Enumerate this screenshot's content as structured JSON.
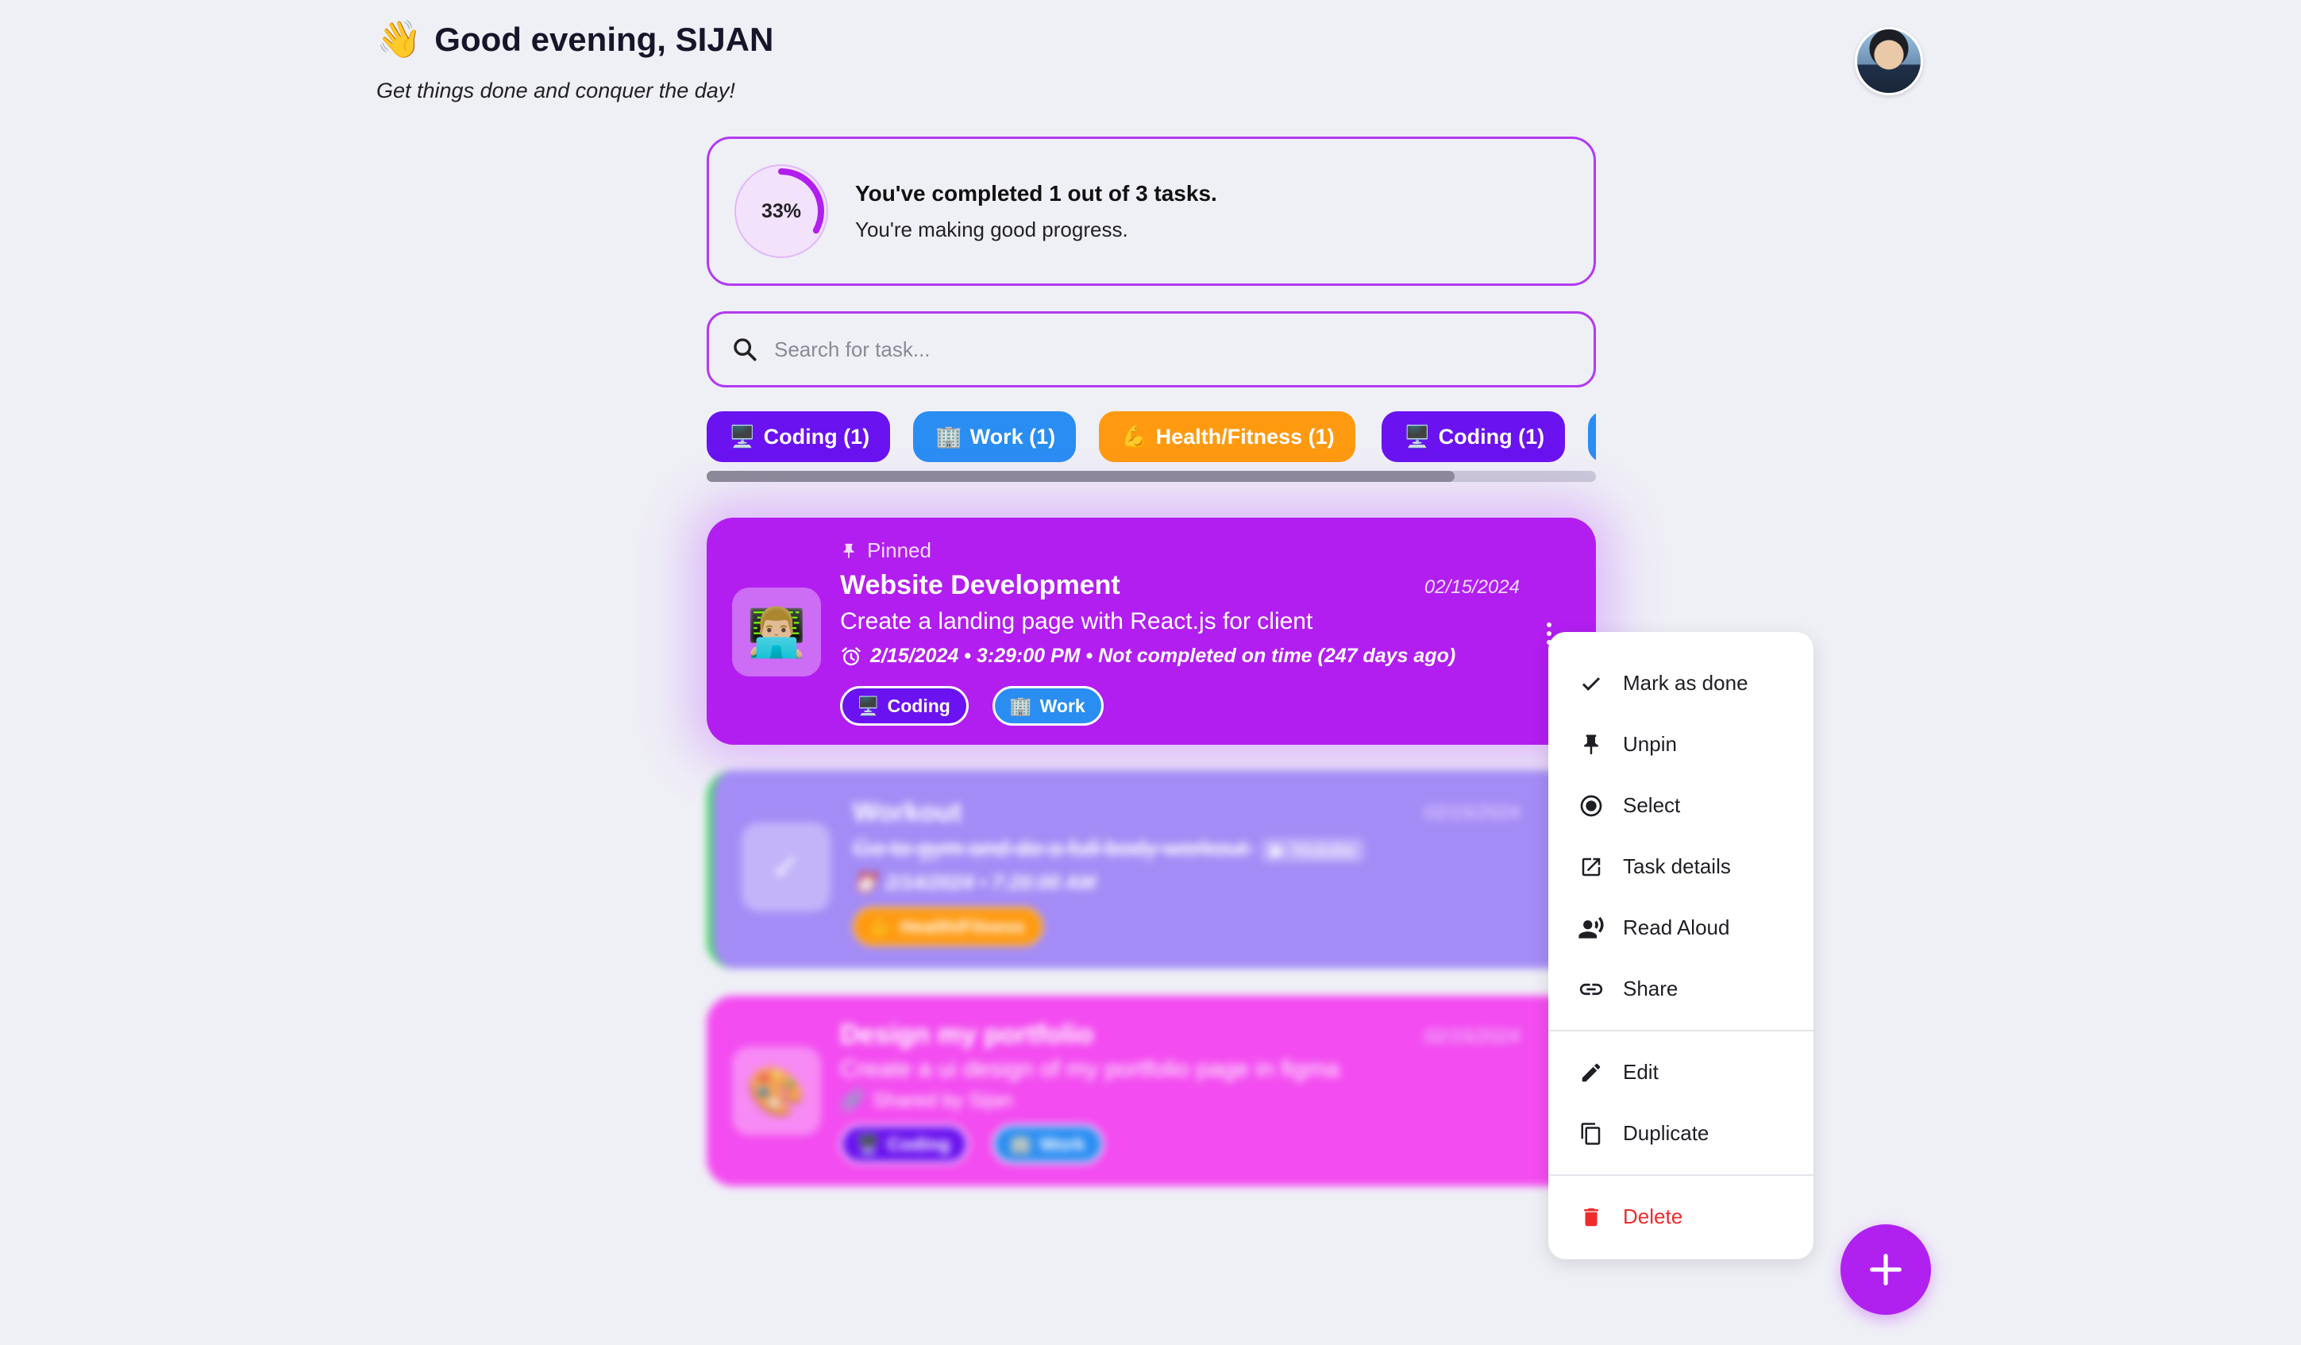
{
  "header": {
    "greeting_emoji": "👋",
    "greeting": "Good evening, SIJAN",
    "subtitle": "Get things done and conquer the day!"
  },
  "progress": {
    "percent_label": "33%",
    "percent": 33,
    "title": "You've completed 1 out of 3 tasks.",
    "subtitle": "You're making good progress.",
    "accent": "#b21ef0"
  },
  "search": {
    "placeholder": "Search for task..."
  },
  "category_chips": [
    {
      "emoji": "🖥️",
      "label": "Coding (1)",
      "color": "#6a12f0"
    },
    {
      "emoji": "🏢",
      "label": "Work (1)",
      "color": "#2a8df2"
    },
    {
      "emoji": "💪",
      "label": "Health/Fitness (1)",
      "color": "#ff9a10"
    },
    {
      "emoji": "🖥️",
      "label": "Coding (1)",
      "color": "#6a12f0"
    }
  ],
  "tasks": [
    {
      "pinned_label": "Pinned",
      "emoji": "👨🏼‍💻",
      "title": "Website Development",
      "date": "02/15/2024",
      "description": "Create a landing page with React.js for client",
      "deadline": "2/15/2024 • 3:29:00 PM • Not completed on time (247 days ago)",
      "tags": [
        {
          "emoji": "🖥️",
          "label": "Coding",
          "color": "#6a12f0"
        },
        {
          "emoji": "🏢",
          "label": "Work",
          "color": "#2a8df2"
        }
      ],
      "color": "#b21ef0"
    },
    {
      "emoji": "✓",
      "title": "Workout",
      "date": "02/15/2024",
      "description": "Go to gym and do a full body workout",
      "link_label": "Youtube",
      "deadline": "2/14/2024 • 7:20:00 AM",
      "tags": [
        {
          "emoji": "💪",
          "label": "Health/Fitness",
          "color": "#ff9a10"
        }
      ],
      "color": "#a48cf6"
    },
    {
      "emoji": "🎨",
      "title": "Design my portfolio",
      "date": "02/15/2024",
      "description": "Create a ui design of my portfolio page in figma",
      "shared": "Shared by Sijan",
      "tags": [
        {
          "emoji": "🖥️",
          "label": "Coding",
          "color": "#6a12f0"
        },
        {
          "emoji": "🏢",
          "label": "Work",
          "color": "#2a8df2"
        }
      ],
      "color": "#f34cf0"
    }
  ],
  "context_menu": {
    "items": [
      {
        "label": "Mark as done",
        "icon": "check-icon"
      },
      {
        "label": "Unpin",
        "icon": "pin-icon"
      },
      {
        "label": "Select",
        "icon": "radio-select-icon"
      },
      {
        "label": "Task details",
        "icon": "open-in-new-icon"
      },
      {
        "label": "Read Aloud",
        "icon": "record-voice-icon"
      },
      {
        "label": "Share",
        "icon": "link-icon"
      }
    ],
    "edit_items": [
      {
        "label": "Edit",
        "icon": "pencil-icon"
      },
      {
        "label": "Duplicate",
        "icon": "copy-icon"
      }
    ],
    "delete": {
      "label": "Delete",
      "icon": "trash-icon",
      "color": "#ef2b2b"
    }
  },
  "fab": {
    "icon": "plus-icon",
    "color": "#b021f0"
  }
}
